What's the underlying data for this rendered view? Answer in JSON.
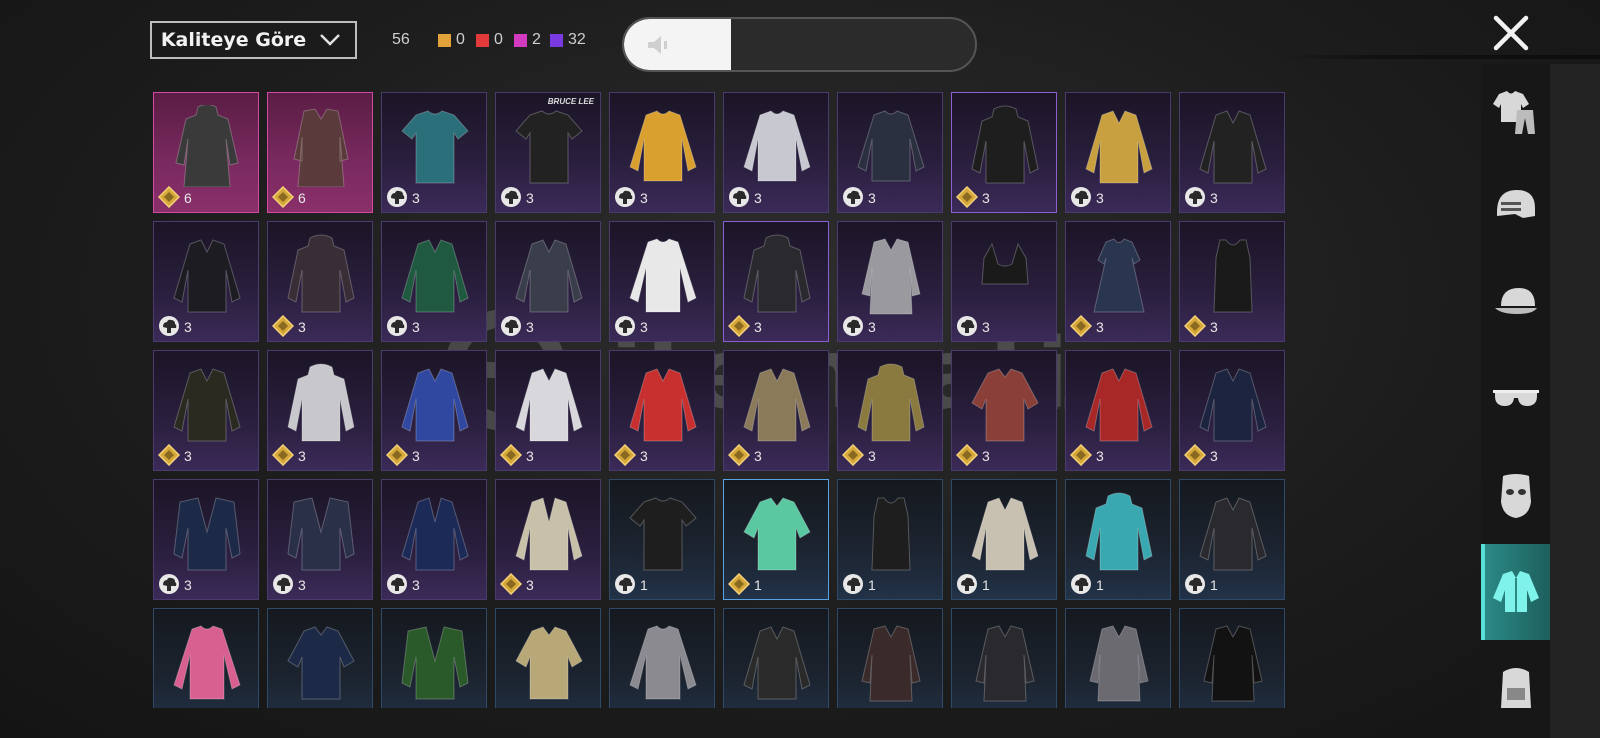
{
  "toolbar": {
    "sort_label": "Kaliteye Göre",
    "total_count": "56",
    "rarity_counts": [
      {
        "color": "#e2a23a",
        "value": "0"
      },
      {
        "color": "#e23a3a",
        "value": "0"
      },
      {
        "color": "#d23ac0",
        "value": "2"
      },
      {
        "color": "#7a3ae2",
        "value": "32"
      }
    ],
    "volume_level": 0.3
  },
  "sidebar": {
    "tabs": [
      {
        "icon": "outfit-icon",
        "active": false
      },
      {
        "icon": "helmet-icon",
        "active": false
      },
      {
        "icon": "cap-icon",
        "active": false
      },
      {
        "icon": "glasses-icon",
        "active": false
      },
      {
        "icon": "mask-icon",
        "active": false
      },
      {
        "icon": "shirt-icon",
        "active": true
      },
      {
        "icon": "backpack-icon",
        "active": false
      }
    ]
  },
  "watermark": {
    "text": "itemsatis",
    "sub": "OYUN / SKIN / E-PIN .com"
  },
  "items": [
    {
      "rarity": "pink",
      "garment": "hooded-coat",
      "color": "#3a3a3a",
      "badge": "diamond",
      "qty": "6"
    },
    {
      "rarity": "pink",
      "garment": "long-coat",
      "color": "#5a3a3a",
      "badge": "diamond",
      "qty": "6"
    },
    {
      "rarity": "purple",
      "garment": "tshirt",
      "color": "#2b6f7a",
      "badge": "cloud",
      "qty": "3"
    },
    {
      "rarity": "purple",
      "garment": "tshirt",
      "color": "#222",
      "badge": "cloud",
      "qty": "3",
      "brand": "BRUCE LEE"
    },
    {
      "rarity": "purple",
      "garment": "sweater",
      "color": "#d9a030",
      "badge": "cloud",
      "qty": "3"
    },
    {
      "rarity": "purple",
      "garment": "sweater",
      "color": "#c8c8d0",
      "badge": "cloud",
      "qty": "3"
    },
    {
      "rarity": "purple",
      "garment": "sweater",
      "color": "#2a3040",
      "badge": "cloud",
      "qty": "3"
    },
    {
      "rarity": "purple",
      "garment": "hoodie",
      "color": "#1e1e1e",
      "badge": "diamond",
      "qty": "3",
      "selected": true
    },
    {
      "rarity": "purple",
      "garment": "jacket",
      "color": "#c8a040",
      "badge": "cloud",
      "qty": "3"
    },
    {
      "rarity": "purple",
      "garment": "jacket",
      "color": "#222",
      "badge": "cloud",
      "qty": "3"
    },
    {
      "rarity": "purple",
      "garment": "jacket",
      "color": "#1c1c22",
      "badge": "cloud",
      "qty": "3"
    },
    {
      "rarity": "purple",
      "garment": "hoodie",
      "color": "#3a2e36",
      "badge": "diamond",
      "qty": "3"
    },
    {
      "rarity": "purple",
      "garment": "jacket",
      "color": "#1f5a40",
      "badge": "cloud",
      "qty": "3"
    },
    {
      "rarity": "purple",
      "garment": "jacket",
      "color": "#3a3e4a",
      "badge": "cloud",
      "qty": "3"
    },
    {
      "rarity": "purple",
      "garment": "raglan",
      "color": "#e8e8e8",
      "badge": "cloud",
      "qty": "3"
    },
    {
      "rarity": "purple",
      "garment": "hoodie",
      "color": "#2a2a2e",
      "badge": "diamond",
      "qty": "3",
      "selected": true
    },
    {
      "rarity": "purple",
      "garment": "coat",
      "color": "#9a9a9e",
      "badge": "cloud",
      "qty": "3"
    },
    {
      "rarity": "purple",
      "garment": "bra",
      "color": "#1a1a1a",
      "badge": "cloud",
      "qty": "3"
    },
    {
      "rarity": "purple",
      "garment": "dress",
      "color": "#2a3550",
      "badge": "diamond",
      "qty": "3"
    },
    {
      "rarity": "purple",
      "garment": "tank",
      "color": "#1a1a1a",
      "badge": "diamond",
      "qty": "3"
    },
    {
      "rarity": "purple",
      "garment": "jacket",
      "color": "#2a2a20",
      "badge": "diamond",
      "qty": "3"
    },
    {
      "rarity": "purple",
      "garment": "hoodie",
      "color": "#c8c8cc",
      "badge": "diamond",
      "qty": "3"
    },
    {
      "rarity": "purple",
      "garment": "jacket",
      "color": "#3048a0",
      "badge": "diamond",
      "qty": "3"
    },
    {
      "rarity": "purple",
      "garment": "jacket",
      "color": "#d8d8dc",
      "badge": "diamond",
      "qty": "3"
    },
    {
      "rarity": "purple",
      "garment": "jacket",
      "color": "#c83030",
      "badge": "diamond",
      "qty": "3"
    },
    {
      "rarity": "purple",
      "garment": "jacket",
      "color": "#8a7a5a",
      "badge": "diamond",
      "qty": "3"
    },
    {
      "rarity": "purple",
      "garment": "hoodie",
      "color": "#8a7a40",
      "badge": "diamond",
      "qty": "3"
    },
    {
      "rarity": "purple",
      "garment": "shirt",
      "color": "#8a4038",
      "badge": "diamond",
      "qty": "3"
    },
    {
      "rarity": "purple",
      "garment": "jacket",
      "color": "#a82828",
      "badge": "diamond",
      "qty": "3"
    },
    {
      "rarity": "purple",
      "garment": "jacket",
      "color": "#1c2440",
      "badge": "diamond",
      "qty": "3"
    },
    {
      "rarity": "purple",
      "garment": "vest",
      "color": "#1c2a48",
      "badge": "cloud",
      "qty": "3"
    },
    {
      "rarity": "purple",
      "garment": "vest",
      "color": "#2a3048",
      "badge": "cloud",
      "qty": "3"
    },
    {
      "rarity": "purple",
      "garment": "blazer",
      "color": "#1c2a58",
      "badge": "cloud",
      "qty": "3"
    },
    {
      "rarity": "purple",
      "garment": "blazer",
      "color": "#c8c0a8",
      "badge": "diamond",
      "qty": "3"
    },
    {
      "rarity": "blue",
      "garment": "tshirt",
      "color": "#1e1e1e",
      "badge": "cloud",
      "qty": "1"
    },
    {
      "rarity": "blue",
      "garment": "shirt",
      "color": "#5ac8a0",
      "badge": "diamond",
      "qty": "1",
      "selected": true
    },
    {
      "rarity": "blue",
      "garment": "tank",
      "color": "#1e1e1e",
      "badge": "cloud",
      "qty": "1"
    },
    {
      "rarity": "blue",
      "garment": "jacket",
      "color": "#c8c0b0",
      "badge": "cloud",
      "qty": "1"
    },
    {
      "rarity": "blue",
      "garment": "hoodie",
      "color": "#3aa8b0",
      "badge": "cloud",
      "qty": "1"
    },
    {
      "rarity": "blue",
      "garment": "jacket",
      "color": "#2a2a2e",
      "badge": "cloud",
      "qty": "1"
    },
    {
      "rarity": "blue",
      "garment": "raglan",
      "color": "#d86090",
      "badge": "none",
      "qty": ""
    },
    {
      "rarity": "blue",
      "garment": "shirt",
      "color": "#1c2a48",
      "badge": "none",
      "qty": ""
    },
    {
      "rarity": "blue",
      "garment": "vest",
      "color": "#2a5a2a",
      "badge": "none",
      "qty": ""
    },
    {
      "rarity": "blue",
      "garment": "shirt",
      "color": "#b8a878",
      "badge": "none",
      "qty": ""
    },
    {
      "rarity": "blue",
      "garment": "raglan",
      "color": "#8a8a90",
      "badge": "none",
      "qty": ""
    },
    {
      "rarity": "blue",
      "garment": "jacket",
      "color": "#2a2a2a",
      "badge": "none",
      "qty": ""
    },
    {
      "rarity": "blue",
      "garment": "coat",
      "color": "#3a2a2a",
      "badge": "none",
      "qty": ""
    },
    {
      "rarity": "blue",
      "garment": "coat",
      "color": "#2a2a2e",
      "badge": "none",
      "qty": ""
    },
    {
      "rarity": "blue",
      "garment": "coat",
      "color": "#6a6a70",
      "badge": "none",
      "qty": ""
    },
    {
      "rarity": "blue",
      "garment": "coat",
      "color": "#121212",
      "badge": "none",
      "qty": ""
    }
  ]
}
